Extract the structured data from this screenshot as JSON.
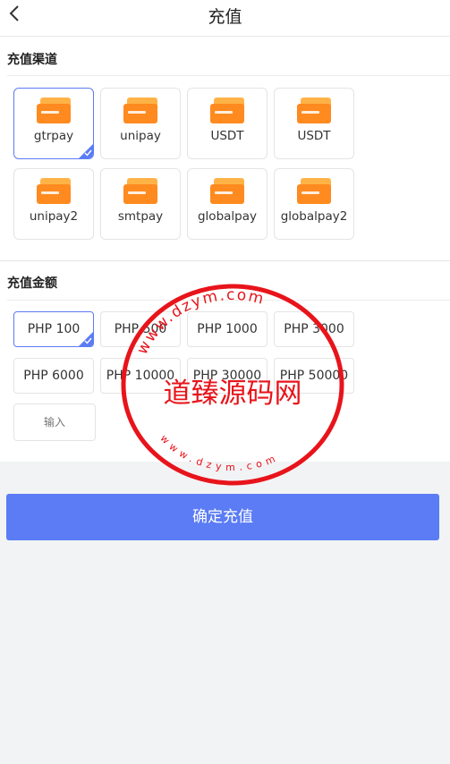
{
  "nav": {
    "title": "充值"
  },
  "channel_section": {
    "title": "充值渠道"
  },
  "channels": [
    {
      "label": "gtrpay",
      "selected": true
    },
    {
      "label": "unipay",
      "selected": false
    },
    {
      "label": "USDT",
      "selected": false
    },
    {
      "label": "USDT",
      "selected": false
    },
    {
      "label": "unipay2",
      "selected": false
    },
    {
      "label": "smtpay",
      "selected": false
    },
    {
      "label": "globalpay",
      "selected": false
    },
    {
      "label": "globalpay2",
      "selected": false
    }
  ],
  "amount_section": {
    "title": "充值金额"
  },
  "amounts": [
    {
      "label": "PHP 100",
      "selected": true
    },
    {
      "label": "PHP 500",
      "selected": false
    },
    {
      "label": "PHP 1000",
      "selected": false
    },
    {
      "label": "PHP 3000",
      "selected": false
    },
    {
      "label": "PHP 6000",
      "selected": false
    },
    {
      "label": "PHP 10000",
      "selected": false
    },
    {
      "label": "PHP 30000",
      "selected": false
    },
    {
      "label": "PHP 50000",
      "selected": false
    }
  ],
  "custom_amount": {
    "placeholder": "输入"
  },
  "confirm_button": {
    "label": "确定充值"
  },
  "watermark": {
    "main_text": "道臻源码网",
    "url_text": "www.dzym.com"
  },
  "colors": {
    "accent": "#5b7cf5",
    "card_icon": "#ff8a1f",
    "stamp": "#e8141b"
  }
}
